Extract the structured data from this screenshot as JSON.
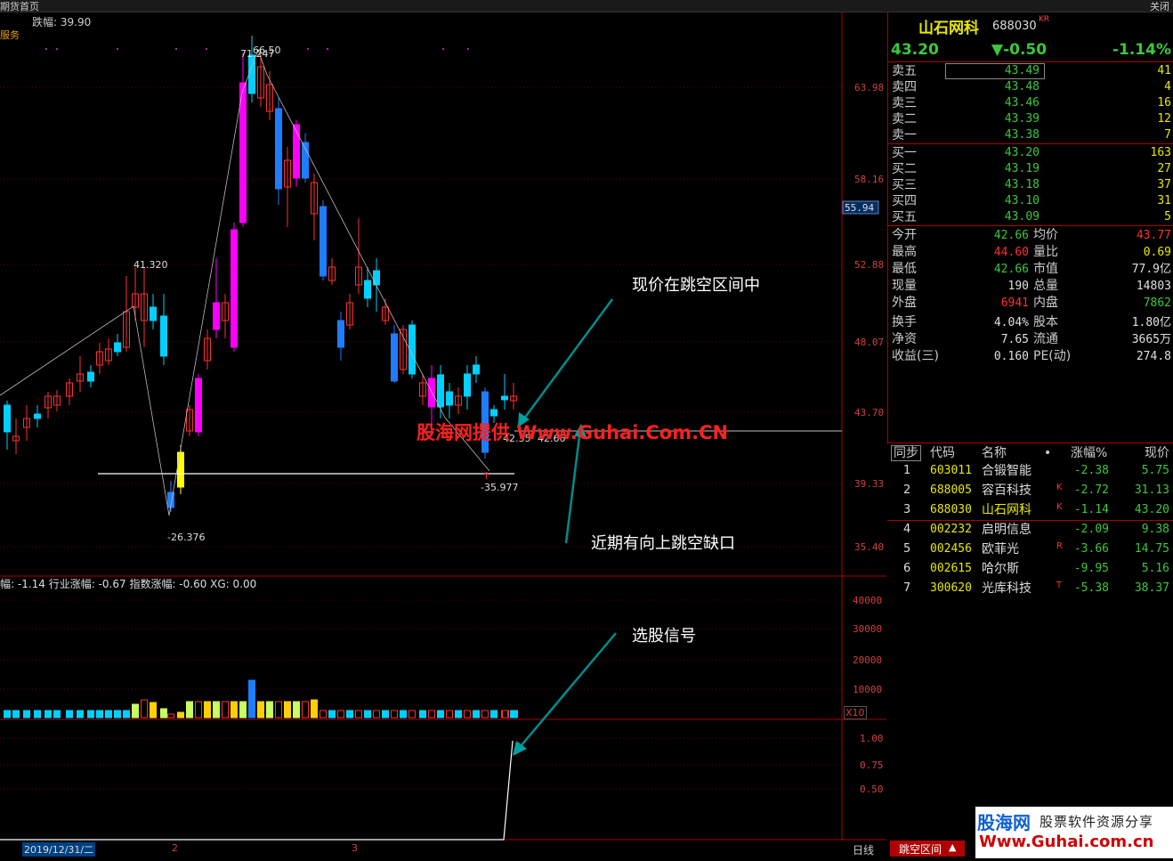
{
  "window": {
    "tab_title": "期货首页",
    "close_label": "关闭"
  },
  "overlay": {
    "amplitude_label": "跌幅: 39.90",
    "service_label": "服务",
    "indicator_line": "幅: -1.14  行业涨幅: -0.67  指数涨幅: -0.60  XG: 0.00",
    "watermark": "股海网提供 Www.Guhai.Com.CN",
    "annotation_gap_current": "现价在跳空区间中",
    "annotation_gap_recent": "近期有向上跳空缺口",
    "annotation_signal": "选股信号",
    "price_marks": [
      "71.247",
      "66.50",
      "41.320",
      "-26.376",
      "-35.977",
      "42.35",
      "42.66"
    ],
    "volume_multiplier": "X10"
  },
  "chart_data": [
    {
      "type": "candlestick",
      "title": "",
      "y_ticks": [
        "63.98",
        "58.16",
        "52.88",
        "48.07",
        "43.70",
        "39.33",
        "35.40"
      ],
      "current_price_tag": "55.94",
      "ylim": [
        35.4,
        66.5
      ]
    },
    {
      "type": "bar",
      "title": "volume",
      "y_ticks": [
        "40000",
        "30000",
        "20000",
        "10000"
      ]
    },
    {
      "type": "line",
      "title": "XG",
      "y_ticks": [
        "1.00",
        "0.75",
        "0.50"
      ],
      "values_tail": [
        0,
        0,
        1
      ]
    }
  ],
  "bottom": {
    "date_label": "2019/12/31/二",
    "marker_2": "2",
    "marker_3": "3",
    "period_label": "日线",
    "formula_label": "跳空区间"
  },
  "quote": {
    "name": "山石网科",
    "code": "688030",
    "badge": "KR",
    "last": "43.20",
    "change": "▼-0.50",
    "change_pct": "-1.14%",
    "asks": [
      {
        "label": "卖五",
        "price": "43.49",
        "vol": "41"
      },
      {
        "label": "卖四",
        "price": "43.48",
        "vol": "4"
      },
      {
        "label": "卖三",
        "price": "43.46",
        "vol": "16"
      },
      {
        "label": "卖二",
        "price": "43.39",
        "vol": "12"
      },
      {
        "label": "卖一",
        "price": "43.38",
        "vol": "7"
      }
    ],
    "bids": [
      {
        "label": "买一",
        "price": "43.20",
        "vol": "163"
      },
      {
        "label": "买二",
        "price": "43.19",
        "vol": "27"
      },
      {
        "label": "买三",
        "price": "43.18",
        "vol": "37"
      },
      {
        "label": "买四",
        "price": "43.10",
        "vol": "31"
      },
      {
        "label": "买五",
        "price": "43.09",
        "vol": "5"
      }
    ],
    "stats_left": [
      {
        "k": "今开",
        "v": "42.66",
        "c": "#3cc83c"
      },
      {
        "k": "最高",
        "v": "44.60",
        "c": "#ff3030"
      },
      {
        "k": "最低",
        "v": "42.66",
        "c": "#3cc83c"
      },
      {
        "k": "现量",
        "v": "190",
        "c": "#e0e0e0"
      },
      {
        "k": "外盘",
        "v": "6941",
        "c": "#ff3030"
      },
      {
        "k": "换手",
        "v": "4.04%",
        "c": "#e0e0e0"
      },
      {
        "k": "净资",
        "v": "7.65",
        "c": "#e0e0e0"
      },
      {
        "k": "收益(三)",
        "v": "0.160",
        "c": "#e0e0e0"
      }
    ],
    "stats_right": [
      {
        "k": "均价",
        "v": "43.77",
        "c": "#ff3030"
      },
      {
        "k": "量比",
        "v": "0.69",
        "c": "#e8e800"
      },
      {
        "k": "市值",
        "v": "77.9亿",
        "c": "#e0e0e0"
      },
      {
        "k": "总量",
        "v": "14803",
        "c": "#e0e0e0"
      },
      {
        "k": "内盘",
        "v": "7862",
        "c": "#3cc83c"
      },
      {
        "k": "股本",
        "v": "1.80亿",
        "c": "#e0e0e0"
      },
      {
        "k": "流通",
        "v": "3665万",
        "c": "#e0e0e0"
      },
      {
        "k": "PE(动)",
        "v": "274.8",
        "c": "#e0e0e0"
      }
    ]
  },
  "list": {
    "headers": {
      "sync": "同步",
      "code": "代码",
      "name": "名称",
      "dot": "•",
      "pct": "涨幅%",
      "price": "现价"
    },
    "rows": [
      {
        "idx": "1",
        "code": "603011",
        "name": "合锻智能",
        "flag": "",
        "pct": "-2.38",
        "price": "5.75"
      },
      {
        "idx": "2",
        "code": "688005",
        "name": "容百科技",
        "flag": "K",
        "pct": "-2.72",
        "price": "31.13"
      },
      {
        "idx": "3",
        "code": "688030",
        "name": "山石网科",
        "flag": "K",
        "pct": "-1.14",
        "price": "43.20"
      },
      {
        "idx": "4",
        "code": "002232",
        "name": "启明信息",
        "flag": "",
        "pct": "-2.09",
        "price": "9.38"
      },
      {
        "idx": "5",
        "code": "002456",
        "name": "欧菲光",
        "flag": "R",
        "pct": "-3.66",
        "price": "14.75"
      },
      {
        "idx": "6",
        "code": "002615",
        "name": "哈尔斯",
        "flag": "",
        "pct": "-9.95",
        "price": "5.16"
      },
      {
        "idx": "7",
        "code": "300620",
        "name": "光库科技",
        "flag": "T",
        "pct": "-5.38",
        "price": "38.37"
      }
    ]
  },
  "logo": {
    "brand": "股海网",
    "slogan": "股票软件资源分享",
    "url": "Www.Guhai.com.cn"
  }
}
